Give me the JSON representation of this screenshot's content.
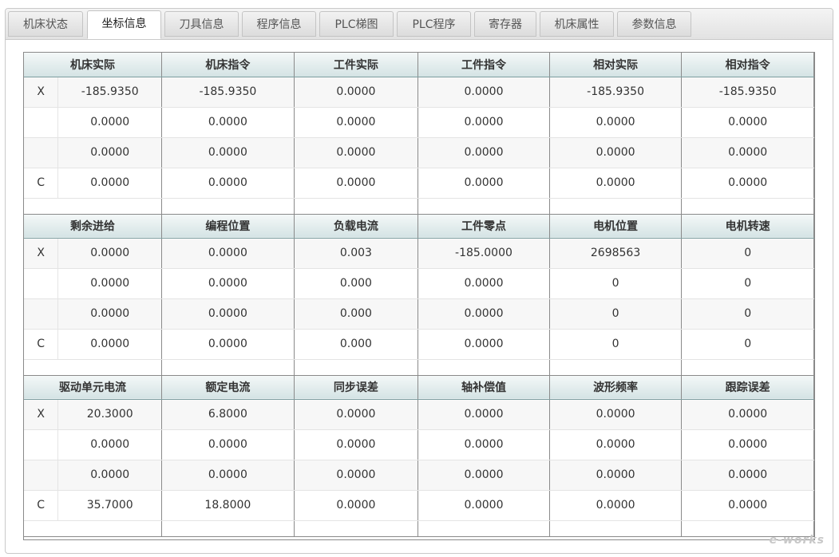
{
  "tabs": [
    {
      "label": "机床状态"
    },
    {
      "label": "坐标信息",
      "active": true
    },
    {
      "label": "刀具信息"
    },
    {
      "label": "程序信息"
    },
    {
      "label": "PLC梯图"
    },
    {
      "label": "PLC程序"
    },
    {
      "label": "寄存器"
    },
    {
      "label": "机床属性"
    },
    {
      "label": "参数信息"
    }
  ],
  "sections": [
    {
      "headers": [
        "机床实际",
        "机床指令",
        "工件实际",
        "工件指令",
        "相对实际",
        "相对指令"
      ],
      "rows": [
        {
          "axis": "X",
          "values": [
            "-185.9350",
            "-185.9350",
            "0.0000",
            "0.0000",
            "-185.9350",
            "-185.9350"
          ]
        },
        {
          "axis": "",
          "values": [
            "0.0000",
            "0.0000",
            "0.0000",
            "0.0000",
            "0.0000",
            "0.0000"
          ]
        },
        {
          "axis": "",
          "values": [
            "0.0000",
            "0.0000",
            "0.0000",
            "0.0000",
            "0.0000",
            "0.0000"
          ]
        },
        {
          "axis": "C",
          "values": [
            "0.0000",
            "0.0000",
            "0.0000",
            "0.0000",
            "0.0000",
            "0.0000"
          ]
        }
      ]
    },
    {
      "headers": [
        "剩余进给",
        "编程位置",
        "负载电流",
        "工件零点",
        "电机位置",
        "电机转速"
      ],
      "rows": [
        {
          "axis": "X",
          "values": [
            "0.0000",
            "0.0000",
            "0.003",
            "-185.0000",
            "2698563",
            "0"
          ]
        },
        {
          "axis": "",
          "values": [
            "0.0000",
            "0.0000",
            "0.000",
            "0.0000",
            "0",
            "0"
          ]
        },
        {
          "axis": "",
          "values": [
            "0.0000",
            "0.0000",
            "0.000",
            "0.0000",
            "0",
            "0"
          ]
        },
        {
          "axis": "C",
          "values": [
            "0.0000",
            "0.0000",
            "0.000",
            "0.0000",
            "0",
            "0"
          ]
        }
      ]
    },
    {
      "headers": [
        "驱动单元电流",
        "额定电流",
        "同步误差",
        "轴补偿值",
        "波形频率",
        "跟踪误差"
      ],
      "rows": [
        {
          "axis": "X",
          "values": [
            "20.3000",
            "6.8000",
            "0.0000",
            "0.0000",
            "0.0000",
            "0.0000"
          ]
        },
        {
          "axis": "",
          "values": [
            "0.0000",
            "0.0000",
            "0.0000",
            "0.0000",
            "0.0000",
            "0.0000"
          ]
        },
        {
          "axis": "",
          "values": [
            "0.0000",
            "0.0000",
            "0.0000",
            "0.0000",
            "0.0000",
            "0.0000"
          ]
        },
        {
          "axis": "C",
          "values": [
            "35.7000",
            "18.8000",
            "0.0000",
            "0.0000",
            "0.0000",
            "0.0000"
          ]
        }
      ]
    }
  ],
  "watermark": "e-works"
}
